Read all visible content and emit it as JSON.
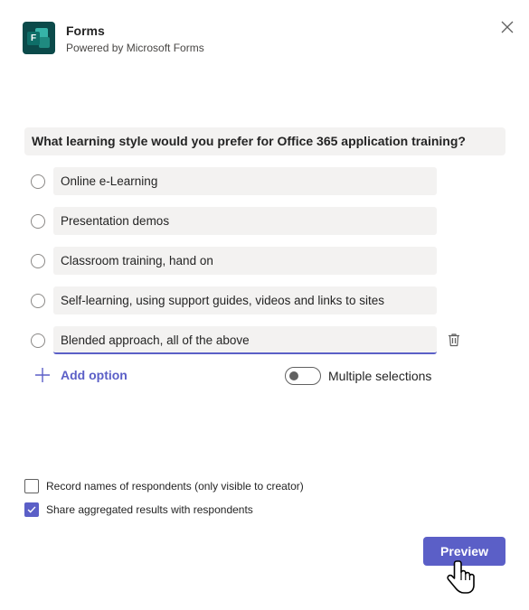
{
  "header": {
    "title": "Forms",
    "subtitle": "Powered by Microsoft Forms",
    "logo_icon": "forms-logo-icon"
  },
  "question": {
    "text": "What learning style would you prefer for Office 365 application training?"
  },
  "options": [
    {
      "label": "Online e-Learning",
      "active": false
    },
    {
      "label": "Presentation demos",
      "active": false
    },
    {
      "label": "Classroom training, hand on",
      "active": false
    },
    {
      "label": "Self-learning, using support guides, videos and links to sites",
      "active": false
    },
    {
      "label": "Blended approach, all of the above",
      "active": true
    }
  ],
  "controls": {
    "add_option_label": "Add option",
    "multiple_selections_label": "Multiple selections",
    "multiple_selections_on": false
  },
  "settings": {
    "record_names_label": "Record names of respondents (only visible to creator)",
    "record_names_checked": false,
    "share_results_label": "Share aggregated results with respondents",
    "share_results_checked": true
  },
  "footer": {
    "preview_label": "Preview"
  },
  "colors": {
    "accent": "#5b5fc7",
    "field_bg": "#f3f2f1",
    "logo_bg": "#0b4a4a"
  }
}
